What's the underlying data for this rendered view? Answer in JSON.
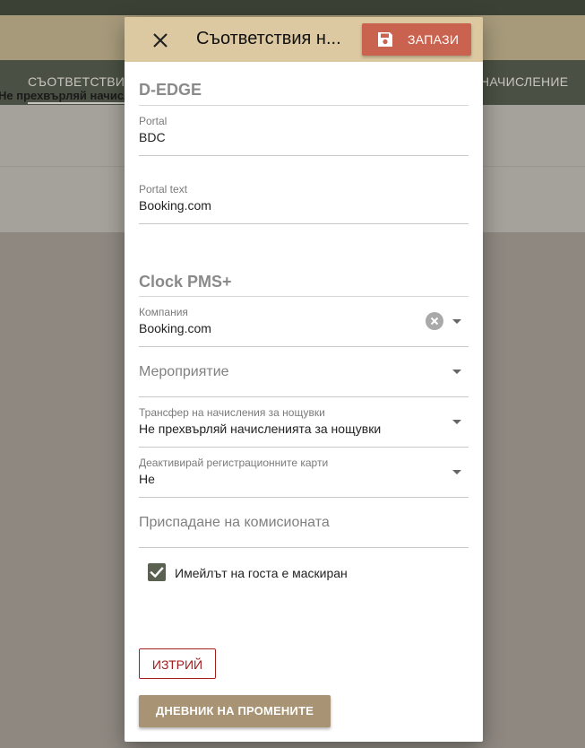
{
  "background": {
    "tab_left": "СЪОТВЕТСТВИЯ",
    "tab_right": "НАЧИСЛЕНИЕ",
    "row_text": "Не прехвърляй начисл"
  },
  "dialog": {
    "title": "Съответствия н...",
    "save_label": "ЗАПАЗИ",
    "close_icon": "close-icon",
    "save_icon": "floppy-disk-icon",
    "d_edge": {
      "section_title": "D-EDGE",
      "portal_label": "Portal",
      "portal_value": "BDC",
      "portal_text_label": "Portal text",
      "portal_text_value": "Booking.com"
    },
    "clock": {
      "section_title": "Clock PMS+",
      "company_label": "Компания",
      "company_value": "Booking.com",
      "event_placeholder": "Мероприятие",
      "night_transfer_label": "Трансфер на начисления за нощувки",
      "night_transfer_value": "Не прехвърляй начисленията за нощувки",
      "deactivate_cards_label": "Деактивирай регистрационните карти",
      "deactivate_cards_value": "Не",
      "commission_placeholder": "Приспадане на комисионата",
      "masked_email_label": "Имейлът на госта е маскиран",
      "masked_email_checked": true
    },
    "delete_label": "ИЗТРИЙ",
    "log_label": "ДНЕВНИК НА ПРОМЕНИТЕ"
  },
  "colors": {
    "header_bg": "#dcc9a1",
    "save_button": "#c9634f",
    "checkbox": "#5b6150",
    "delete_text": "#a02020",
    "log_button": "#a89474"
  }
}
